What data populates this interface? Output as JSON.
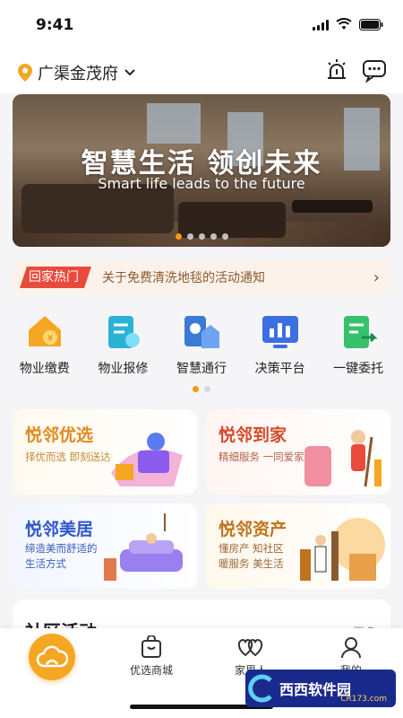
{
  "status_bar": {
    "time": "9:41"
  },
  "header": {
    "community": "广渠金茂府"
  },
  "banner": {
    "headline": "智慧生活 领创未来",
    "subtitle": "Smart life leads to the future",
    "slide_count": 5,
    "active_slide": 1
  },
  "notice": {
    "tag": "回家热门",
    "text": "关于免费清洗地毯的活动通知"
  },
  "services": [
    {
      "label": "物业缴费",
      "icon": "house-coin-icon"
    },
    {
      "label": "物业报修",
      "icon": "repair-doc-icon"
    },
    {
      "label": "智慧通行",
      "icon": "smart-pass-icon"
    },
    {
      "label": "决策平台",
      "icon": "chart-screen-icon"
    },
    {
      "label": "一键委托",
      "icon": "delegate-doc-icon"
    }
  ],
  "services_pager": {
    "pages": 2,
    "active": 1
  },
  "cards": [
    {
      "title": "悦邻优选",
      "sub1": "择优而选  即刻送达",
      "sub2": ""
    },
    {
      "title": "悦邻到家",
      "sub1": "精细服务 一同爱家",
      "sub2": ""
    },
    {
      "title": "悦邻美居",
      "sub1": "缔造美而舒适的",
      "sub2": "生活方式"
    },
    {
      "title": "悦邻资产",
      "sub1": "懂房产 知社区",
      "sub2": "暖服务 美生活"
    }
  ],
  "section": {
    "title": "社区活动",
    "more": "更多"
  },
  "tabbar": {
    "tabs": [
      {
        "label": "",
        "icon": "cloud-home-icon"
      },
      {
        "label": "优选商城",
        "icon": "shopping-bag-icon"
      },
      {
        "label": "家里人",
        "icon": "hearts-icon"
      },
      {
        "label": "我的",
        "icon": "user-icon"
      }
    ]
  },
  "watermark": {
    "text": "西西软件园",
    "url": "CR173.com"
  },
  "colors": {
    "accent": "#f5a623",
    "notice_tag": "#e94a3c"
  }
}
